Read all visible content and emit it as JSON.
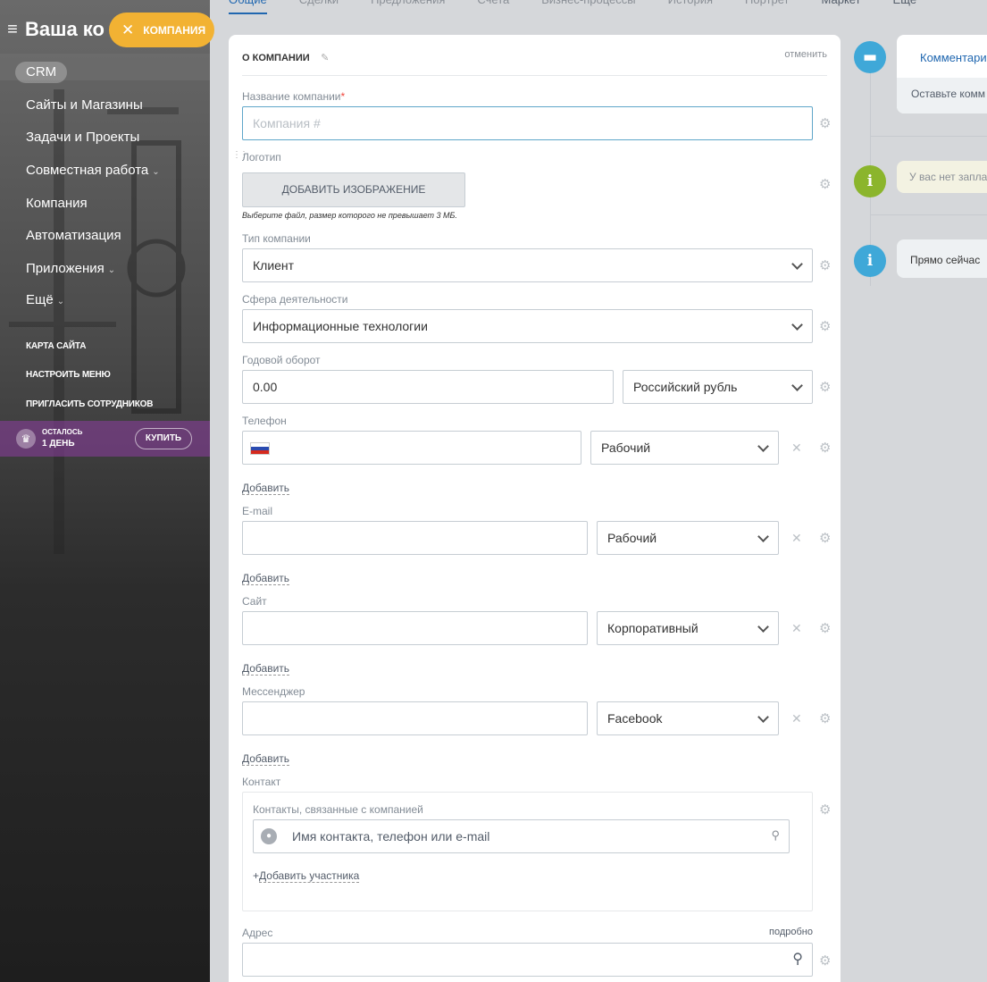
{
  "sidebar": {
    "title": "Ваша ко",
    "company_pill": "КОМПАНИЯ",
    "crm": "CRM",
    "items": [
      "Сайты и Магазины",
      "Задачи и Проекты",
      "Совместная работа",
      "Компания",
      "Автоматизация",
      "Приложения",
      "Ещё"
    ],
    "small": [
      "КАРТА САЙТА",
      "НАСТРОИТЬ МЕНЮ",
      "ПРИГЛАСИТЬ СОТРУДНИКОВ"
    ],
    "trial_line1": "ОСТАЛОСЬ",
    "trial_line2": "1 ДЕНЬ",
    "buy": "КУПИТЬ"
  },
  "tabs": [
    "Общие",
    "Сделки",
    "Предложения",
    "Счета",
    "Бизнес-процессы",
    "История",
    "Портрет",
    "Маркет",
    "Ещё"
  ],
  "card": {
    "title": "О КОМПАНИИ",
    "cancel": "отменить",
    "name_label": "Название компании",
    "name_required": "*",
    "name_placeholder": "Компания #",
    "logo_label": "Логотип",
    "add_image": "ДОБАВИТЬ ИЗОБРАЖЕНИЕ",
    "image_hint": "Выберите файл, размер которого не превышает 3 МБ.",
    "type_label": "Тип компании",
    "type_value": "Клиент",
    "industry_label": "Сфера деятельности",
    "industry_value": "Информационные технологии",
    "revenue_label": "Годовой оборот",
    "revenue_value": "0.00",
    "currency_value": "Российский рубль",
    "phone_label": "Телефон",
    "phone_type": "Рабочий",
    "add": "Добавить",
    "email_label": "E-mail",
    "email_type": "Рабочий",
    "site_label": "Сайт",
    "site_type": "Корпоративный",
    "messenger_label": "Мессенджер",
    "messenger_type": "Facebook",
    "contact_label": "Контакт",
    "contacts_sub": "Контакты, связанные с компанией",
    "contacts_placeholder": "Имя контакта, телефон или e-mail",
    "add_member_plus": "+",
    "add_member": "Добавить участника",
    "address_label": "Адрес",
    "address_more": "подробно"
  },
  "timeline": {
    "comments_tab": "Комментари",
    "comment_placeholder": "Оставьте комм",
    "no_plans": "У вас нет запла",
    "now": "Прямо сейчас"
  },
  "colors": {
    "accent": "#2067b0",
    "pill": "#f2b233",
    "comment_icon": "#3fa8d8",
    "info_green": "#8bb52c",
    "info_blue": "#3fa8d8"
  }
}
